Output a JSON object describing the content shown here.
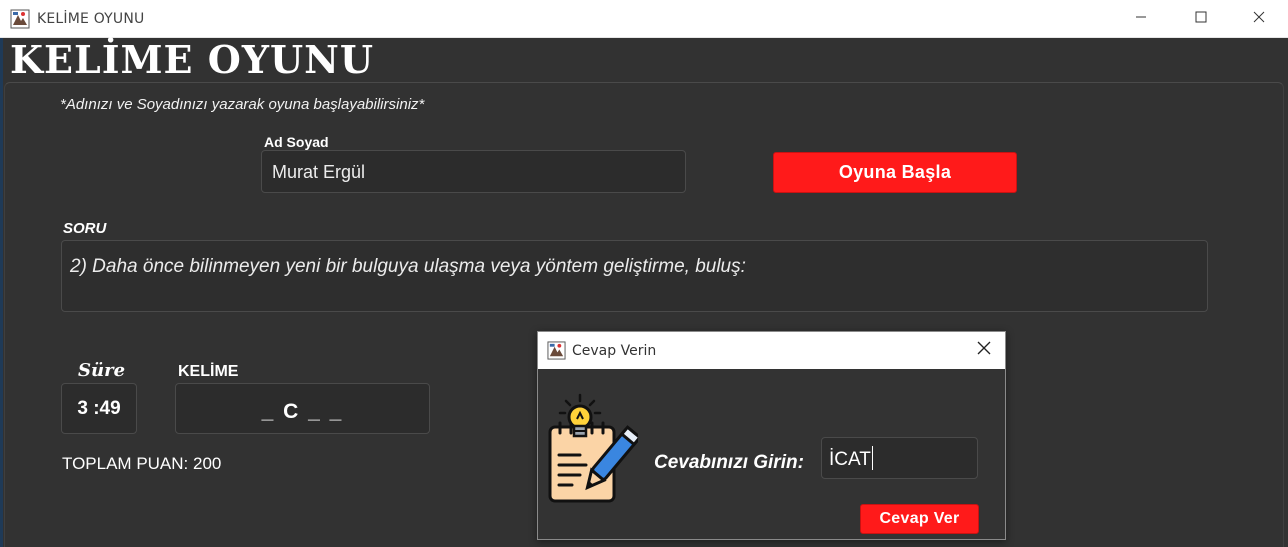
{
  "window": {
    "title": "KELİME OYUNU",
    "icon": "java-app-icon",
    "controls": [
      "minimize-icon",
      "maximize-icon",
      "close-icon"
    ]
  },
  "header": {
    "title": "KELİME OYUNU"
  },
  "intro": {
    "instruction": "*Adınızı ve Soyadınızı yazarak oyuna başlayabilirsiniz*",
    "name_label": "Ad Soyad",
    "name_value": "Murat Ergül",
    "start_button": "Oyuna Başla"
  },
  "question": {
    "label": "SORU",
    "text": "2) Daha önce bilinmeyen yeni bir bulguya ulaşma veya yöntem geliştirme, buluş:"
  },
  "timer": {
    "label": "Süre",
    "value": "3 :49"
  },
  "word": {
    "label": "KELİME",
    "pattern": "_ C _ _"
  },
  "score": {
    "text": "TOPLAM PUAN: 200"
  },
  "dialog": {
    "title": "Cevap Verin",
    "icon": "java-app-icon",
    "illustration": "idea-notepad-pencil-icon",
    "answer_label": "Cevabınızı Girin:",
    "answer_value": "İCAT",
    "submit_button": "Cevap Ver"
  },
  "colors": {
    "background": "#323232",
    "accent": "#ff1a1a",
    "field": "#2c2c2c",
    "text": "#ffffff"
  }
}
